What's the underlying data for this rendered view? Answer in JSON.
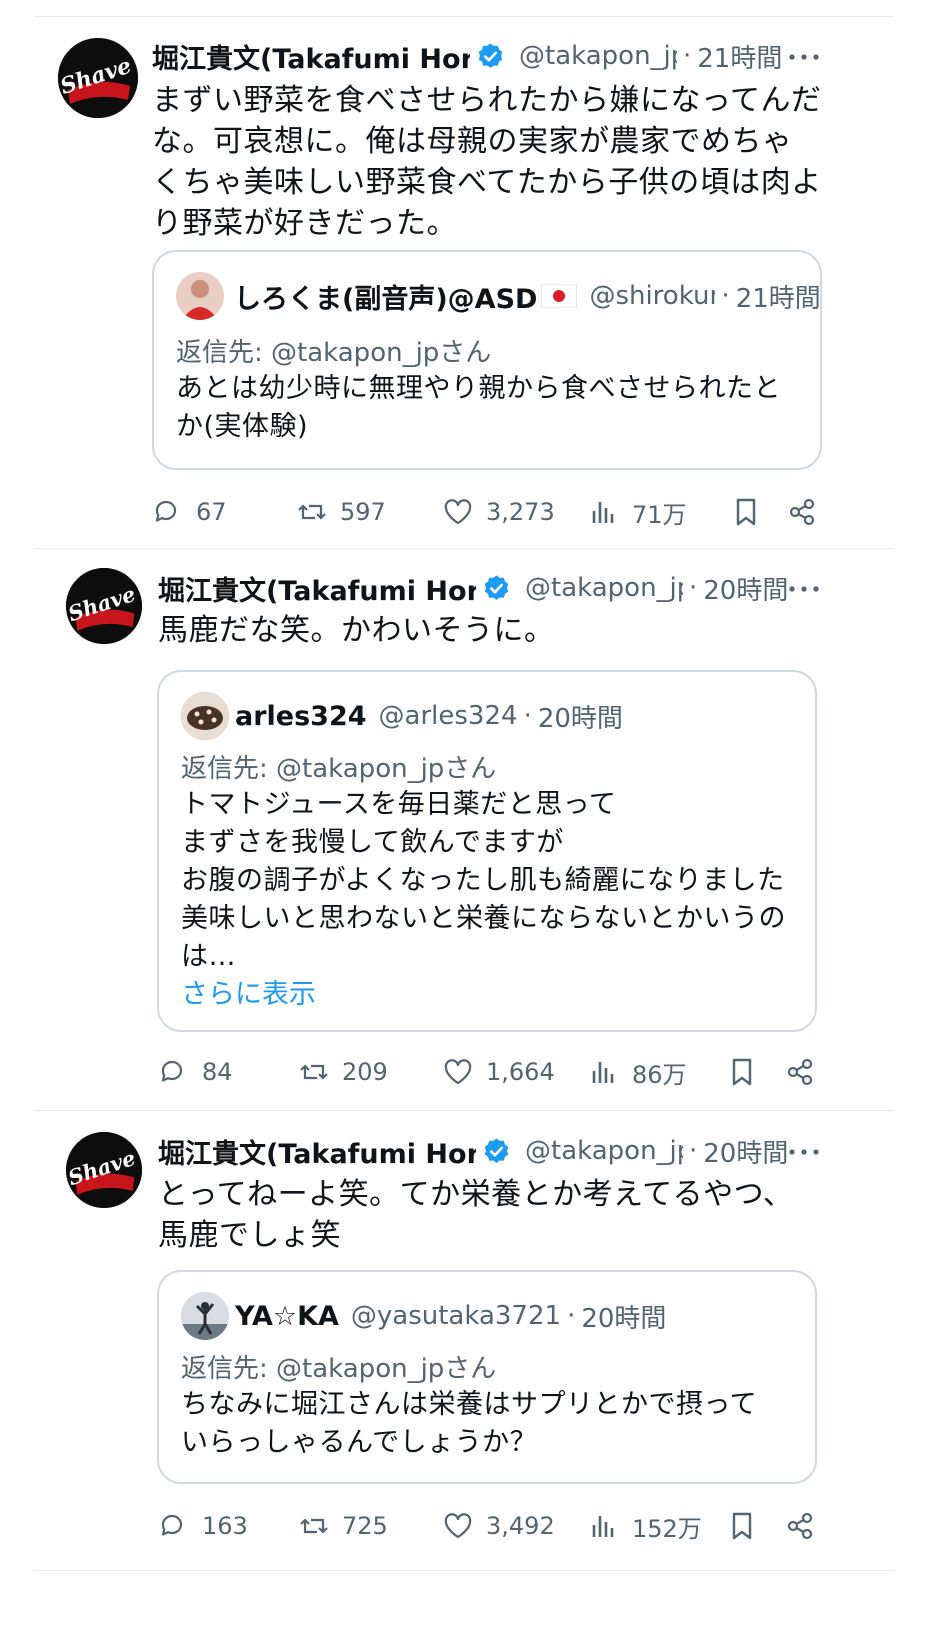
{
  "posts": [
    {
      "author": "堀江貴文(Takafumi Horie)",
      "handle": "@takapon_jp",
      "sep": "·",
      "time": "21時間",
      "text": "まずい野菜を食べさせられたから嫌になってんだな。可哀想に。俺は母親の実家が農家でめちゃくちゃ美味しい野菜食べてたから子供の頃は肉より野菜が好きだった。",
      "quote": {
        "name": "しろくま(副音声)@ASD",
        "handle": "@shirokuma",
        "sep": "·",
        "time": "21時間",
        "reply_to": "返信先: @takapon_jpさん",
        "text": "あとは幼少時に無理やり親から食べさせられたとか(実体験)"
      },
      "stats": {
        "replies": "67",
        "reposts": "597",
        "likes": "3,273",
        "views": "71万"
      }
    },
    {
      "author": "堀江貴文(Takafumi Horie)",
      "handle": "@takapon_jp",
      "sep": "·",
      "time": "20時間",
      "text": "馬鹿だな笑。かわいそうに。",
      "quote": {
        "name": "arles324",
        "handle": "@arles324",
        "sep": "·",
        "time": "20時間",
        "reply_to": "返信先: @takapon_jpさん",
        "lines": [
          "トマトジュースを毎日薬だと思って",
          "まずさを我慢して飲んでますが",
          "お腹の調子がよくなったし肌も綺麗になりました",
          "美味しいと思わないと栄養にならないとかいうのは…"
        ],
        "show_more": "さらに表示"
      },
      "stats": {
        "replies": "84",
        "reposts": "209",
        "likes": "1,664",
        "views": "86万"
      }
    },
    {
      "author": "堀江貴文(Takafumi Horie)",
      "handle": "@takapon_jp",
      "sep": "·",
      "time": "20時間",
      "text": "とってねーよ笑。てか栄養とか考えてるやつ、馬鹿でしょ笑",
      "quote": {
        "name": "YA☆KA",
        "handle": "@yasutaka3721",
        "sep": "·",
        "time": "20時間",
        "reply_to": "返信先: @takapon_jpさん",
        "text": "ちなみに堀江さんは栄養はサプリとかで摂っていらっしゃるんでしょうか？"
      },
      "stats": {
        "replies": "163",
        "reposts": "725",
        "likes": "3,492",
        "views": "152万"
      }
    }
  ],
  "avatar_logo_text": "Shave",
  "colors": {
    "verified": "#1d9bf0",
    "text": "#0f1419",
    "muted": "#536471",
    "link": "#1d9bf0",
    "border": "#cfd9de"
  }
}
